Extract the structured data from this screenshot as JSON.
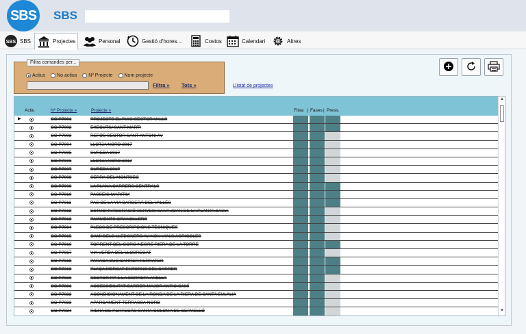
{
  "header": {
    "logo_text": "SBS",
    "app_name": "SBS",
    "title_value": ""
  },
  "tabs": [
    {
      "label": "SBS",
      "icon": "sbs-logo-icon",
      "active": false
    },
    {
      "label": "Projectes",
      "icon": "building-icon",
      "active": true
    },
    {
      "label": "Personal",
      "icon": "people-icon",
      "active": false
    },
    {
      "label": "Gestió d'hores...",
      "icon": "clock-icon",
      "active": false
    },
    {
      "label": "Costos",
      "icon": "calculator-icon",
      "active": false
    },
    {
      "label": "Calendari",
      "icon": "calendar-icon",
      "active": false
    },
    {
      "label": "Altres",
      "icon": "gear-icon",
      "active": false
    }
  ],
  "filter": {
    "legend": "Filtra comandes per...",
    "options": [
      {
        "label": "Actius",
        "selected": true
      },
      {
        "label": "No actius",
        "selected": false
      },
      {
        "label": "Nº Projecte",
        "selected": false
      },
      {
        "label": "Nom projecte",
        "selected": false
      }
    ],
    "input_value": "",
    "filtra_label": "Filtra »",
    "tots_label": "Tots »"
  },
  "llistat_label": "Llistat de projectes",
  "toolbar": {
    "add_icon": "plus-circle-icon",
    "refresh_icon": "refresh-icon",
    "print_icon": "printer-icon"
  },
  "grid": {
    "columns": {
      "actiu": "Actiu",
      "num": "Nº Projecte »",
      "projecte": "Projecte »",
      "fitxa": "Fitxa",
      "sep1": "|",
      "fases": "Fases",
      "sep2": "|",
      "press": "Press."
    },
    "colors": {
      "filled": "#4e7f86",
      "empty": "#d3d6d8",
      "header_bg": "#7fc3d6"
    },
    "rows": [
      {
        "num": "CC-P7001",
        "nom": "PROJECTE EL PUIG SECTOR VALLS",
        "fitxa": true,
        "fases": true,
        "press": true
      },
      {
        "num": "CC-P7002",
        "nom": "EXECUTIU SANT MARTI",
        "fitxa": true,
        "fases": true,
        "press": true
      },
      {
        "num": "CC-P7003",
        "nom": "REFÓS SECTOR SANT ANTONI AV",
        "fitxa": true,
        "fases": true,
        "press": false
      },
      {
        "num": "CC-P7004",
        "nom": "LLOTJA NORD 2017",
        "fitxa": true,
        "fases": true,
        "press": false
      },
      {
        "num": "CC-P7005",
        "nom": "SUREDA 2017",
        "fitxa": true,
        "fases": true,
        "press": false
      },
      {
        "num": "CC-P7006",
        "nom": "LLOTJA NORD 2017",
        "fitxa": true,
        "fases": true,
        "press": false
      },
      {
        "num": "CC-P7007",
        "nom": "SUREDA 2017",
        "fitxa": true,
        "fases": true,
        "press": false
      },
      {
        "num": "CC-P7008",
        "nom": "SERRA DEL MONTSEC",
        "fitxa": true,
        "fases": true,
        "press": false
      },
      {
        "num": "CC-P7009",
        "nom": "LA PLANA CARRERS CENTRALS",
        "fitxa": true,
        "fases": true,
        "press": true
      },
      {
        "num": "CC-P7010",
        "nom": "PASSEIG MARITIM",
        "fitxa": true,
        "fases": true,
        "press": true
      },
      {
        "num": "CC-P7011",
        "nom": "PAS DE LA VIA BARBERÀ DEL VALLÈS",
        "fitxa": true,
        "fases": true,
        "press": true
      },
      {
        "num": "CC-P7012",
        "nom": "ESTUDI INTEGRACIÓ SERVEIS SANT JOAN DE LA PLANTA BAIXA",
        "fitxa": true,
        "fases": true,
        "press": false
      },
      {
        "num": "CC-P7013",
        "nom": "PAVIMENTS GRANOLLERS",
        "fitxa": true,
        "fases": true,
        "press": false
      },
      {
        "num": "CC-P7014",
        "nom": "PLECS DE PRESCRIPCIONS TÈCNIQUES",
        "fitxa": true,
        "fases": true,
        "press": false
      },
      {
        "num": "CC-P7015",
        "nom": "CAMÍ DELS LLEDONERS AV NOU VIALS AGRICOLES",
        "fitxa": true,
        "fases": true,
        "press": false
      },
      {
        "num": "CC-P7016",
        "nom": "TORRENT DEL GORG NEGRE RIERA DE LA TORRE",
        "fitxa": true,
        "fases": true,
        "press": true
      },
      {
        "num": "CC-P7017",
        "nom": "VIA VERDA DEL LLOBREGAT",
        "fitxa": true,
        "fases": true,
        "press": false
      },
      {
        "num": "CC-P7018",
        "nom": "PARADA BUS CARRER FERRATER",
        "fitxa": true,
        "fases": true,
        "press": true
      },
      {
        "num": "CC-P7019",
        "nom": "PLAÇA MERCAT ENTORNS DEL CARRER",
        "fitxa": true,
        "fases": true,
        "press": true
      },
      {
        "num": "CC-P7020",
        "nom": "SECTOR PP-1 LA GERRETA ANELLA",
        "fitxa": true,
        "fases": true,
        "press": false
      },
      {
        "num": "CC-P7021",
        "nom": "ACCESSIBILITAT CARRER MAJOR ANTIC CAMÍ",
        "fitxa": true,
        "fases": true,
        "press": false
      },
      {
        "num": "CC-P7022",
        "nom": "ACONDICIONAMENT DE LA RONDA DE LA RIERA DE SANTA EULÀLIA",
        "fitxa": true,
        "fases": true,
        "press": false
      },
      {
        "num": "CC-P7023",
        "nom": "APARCAMENT TERRASSA NORD",
        "fitxa": true,
        "fases": true,
        "press": false
      },
      {
        "num": "CC-P7024",
        "nom": "RIERA DE PERTEGÀS SANTA COLOMA DE CERVELLÓ",
        "fitxa": true,
        "fases": true,
        "press": false
      }
    ]
  }
}
